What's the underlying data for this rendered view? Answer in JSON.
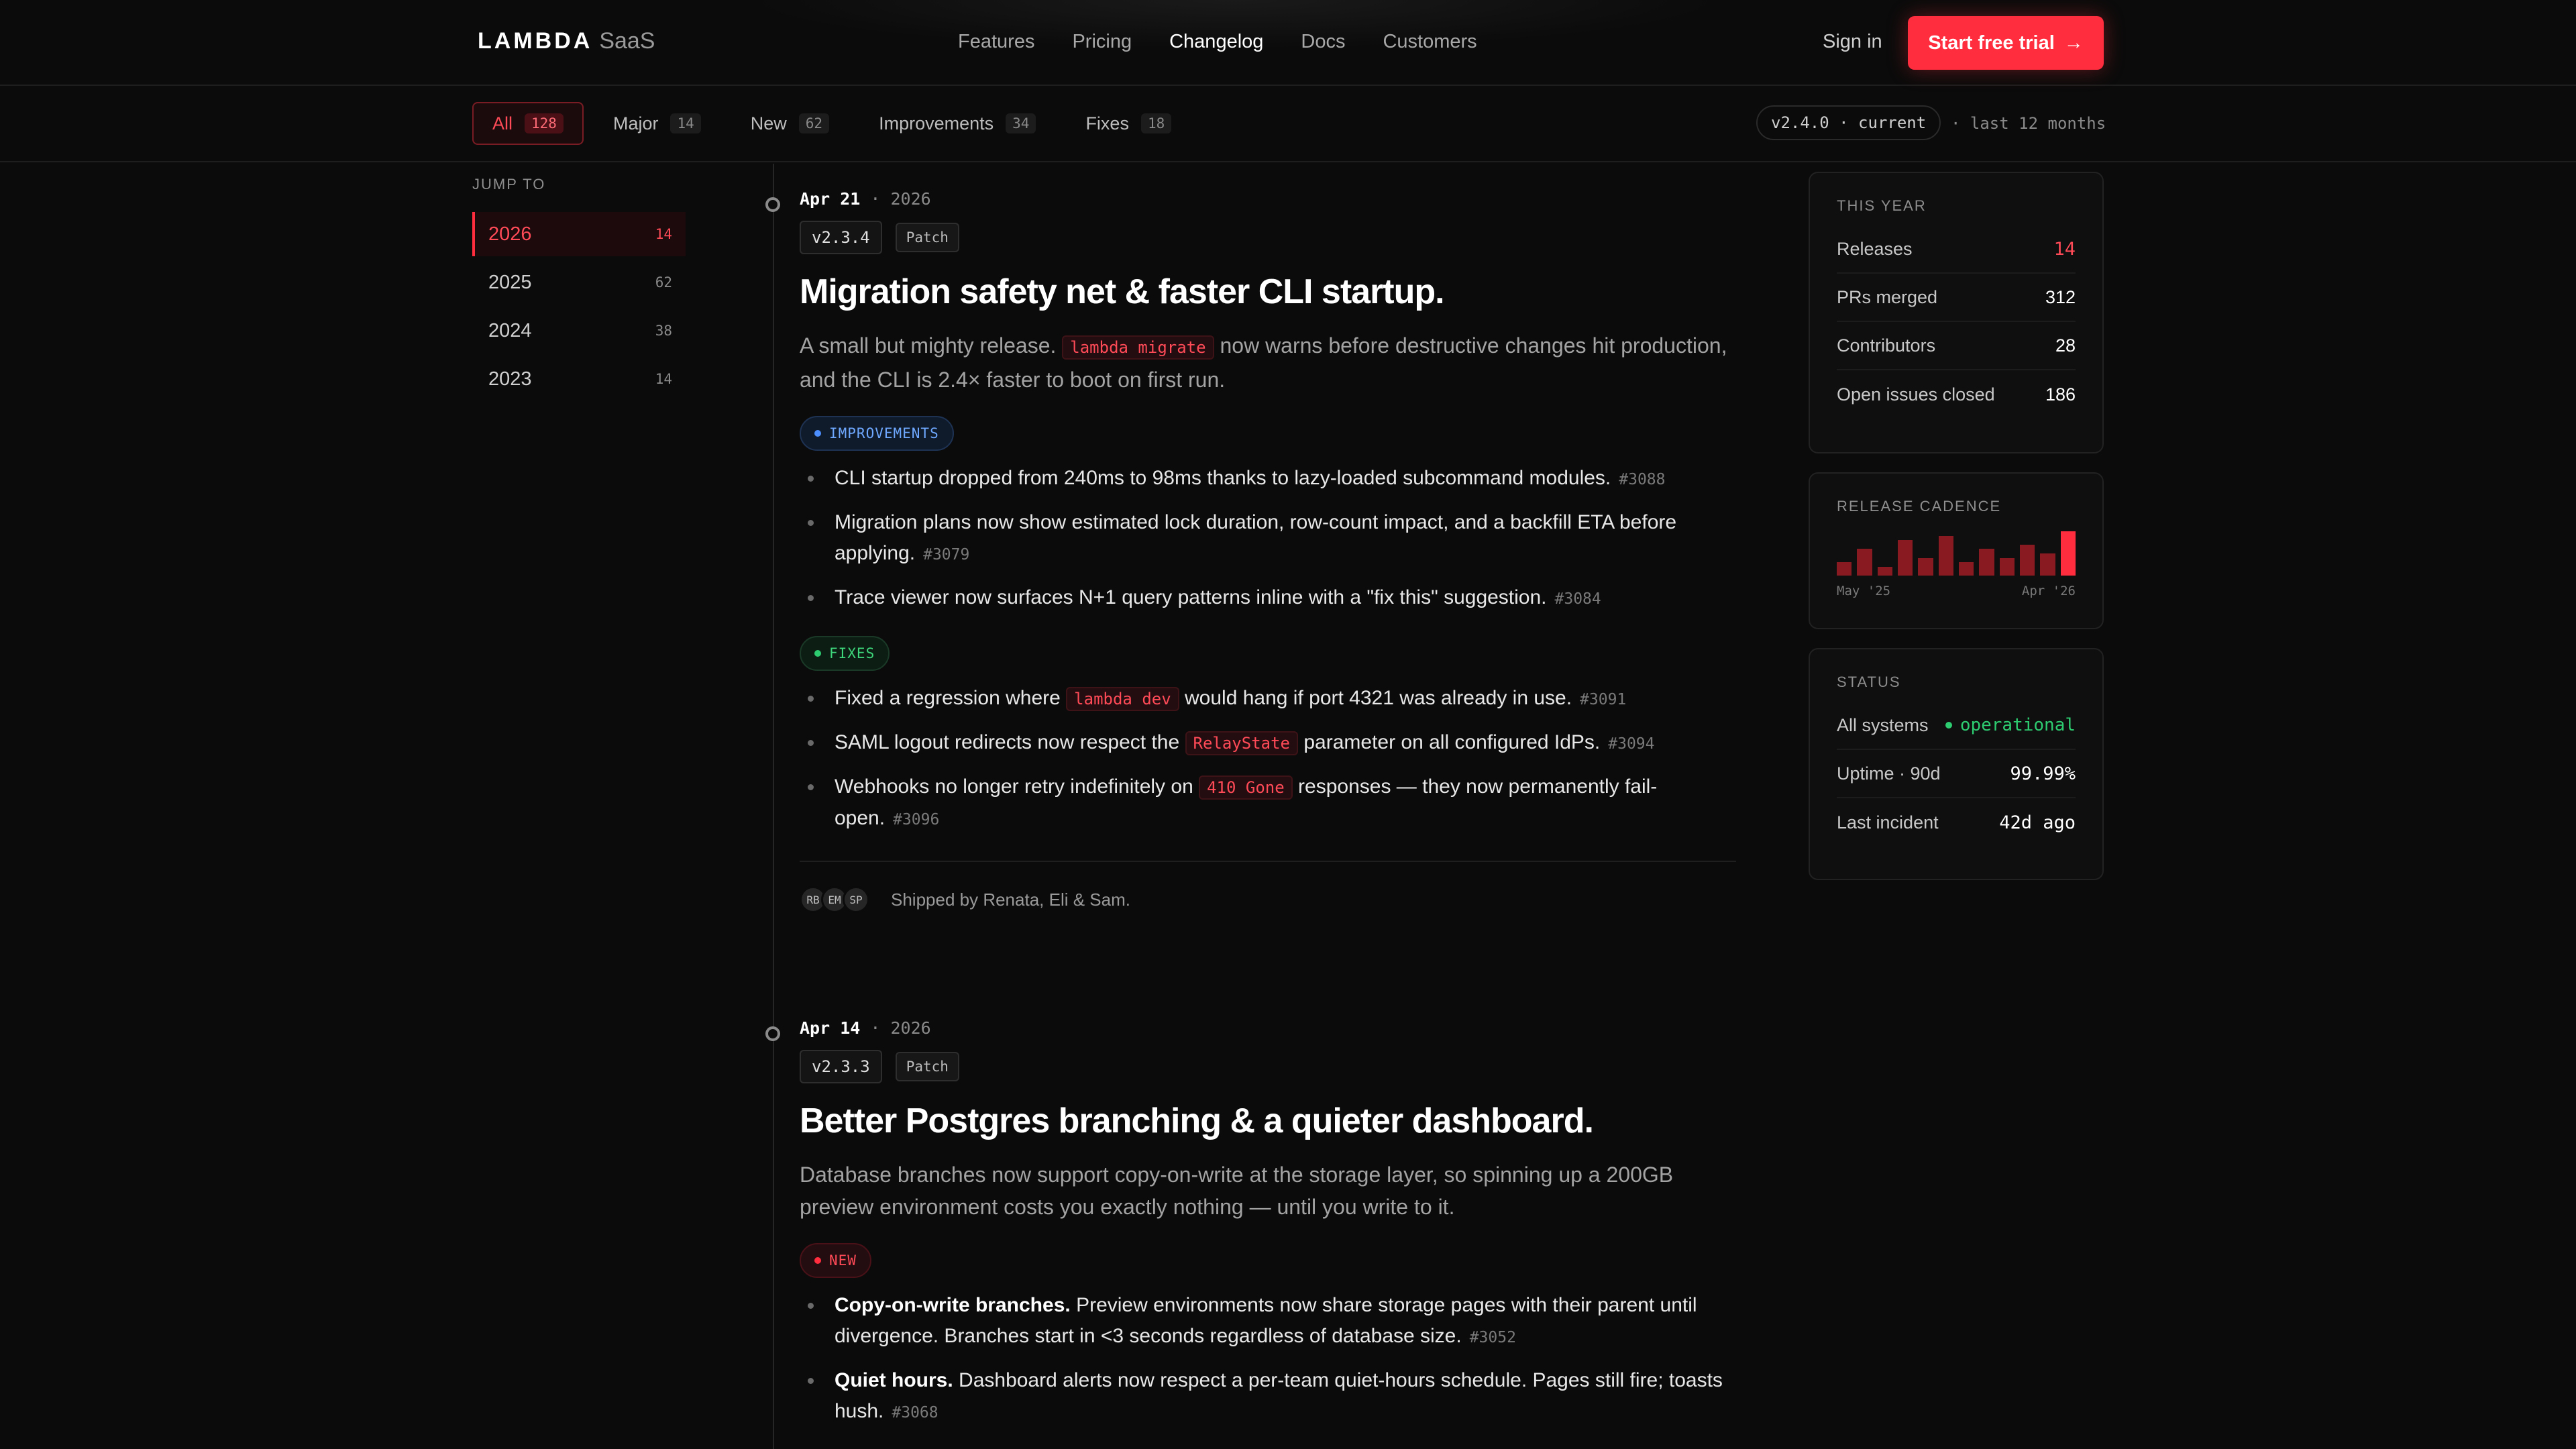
{
  "nav": {
    "brand": "LAMBDA",
    "product": "SaaS",
    "links": [
      "Features",
      "Pricing",
      "Changelog",
      "Docs",
      "Customers"
    ],
    "active_link": "Changelog",
    "signin": "Sign in",
    "cta": "Start free trial",
    "cta_arrow": "→"
  },
  "filters": {
    "chips": [
      {
        "label": "All",
        "count": "128"
      },
      {
        "label": "Major",
        "count": "14"
      },
      {
        "label": "New",
        "count": "62"
      },
      {
        "label": "Improvements",
        "count": "34"
      },
      {
        "label": "Fixes",
        "count": "18"
      }
    ],
    "version": "v2.4.0 · current",
    "range": "· last 12 months"
  },
  "sidebar": {
    "jump_label": "JUMP TO",
    "years": [
      {
        "year": "2026",
        "count": "14"
      },
      {
        "year": "2025",
        "count": "62"
      },
      {
        "year": "2024",
        "count": "38"
      },
      {
        "year": "2023",
        "count": "14"
      }
    ]
  },
  "entries": [
    {
      "date": "Apr 21",
      "year": "· 2026",
      "version": "v2.3.4",
      "kind": "Patch",
      "title": "Migration safety net & faster CLI startup.",
      "lead_pre": "A small but mighty release.",
      "lead_code": "lambda migrate",
      "lead_post": "now warns before destructive changes hit production, and the CLI is 2.4× faster to boot on first run.",
      "improvements_label": "IMPROVEMENTS",
      "improvements": [
        {
          "text": "CLI startup dropped from 240ms to 98ms thanks to lazy-loaded subcommand modules.",
          "pr": "#3088"
        },
        {
          "text": "Migration plans now show estimated lock duration, row-count impact, and a backfill ETA before applying.",
          "pr": "#3079"
        },
        {
          "text": "Trace viewer now surfaces N+1 query patterns inline with a \"fix this\" suggestion.",
          "pr": "#3084"
        }
      ],
      "fixes_label": "FIXES",
      "fixes": [
        {
          "pre": "Fixed a regression where",
          "code": "lambda dev",
          "post": "would hang if port 4321 was already in use.",
          "pr": "#3091"
        },
        {
          "pre": "SAML logout redirects now respect the",
          "code": "RelayState",
          "post": "parameter on all configured IdPs.",
          "pr": "#3094"
        },
        {
          "pre": "Webhooks no longer retry indefinitely on",
          "code": "410 Gone",
          "post": "responses — they now permanently fail-open.",
          "pr": "#3096"
        }
      ],
      "avatars": [
        "RB",
        "EM",
        "SP"
      ],
      "shipped": "Shipped by Renata, Eli & Sam."
    },
    {
      "date": "Apr 14",
      "year": "· 2026",
      "version": "v2.3.3",
      "kind": "Patch",
      "title": "Better Postgres branching & a quieter dashboard.",
      "lead": "Database branches now support copy-on-write at the storage layer, so spinning up a 200GB preview environment costs you exactly nothing — until you write to it.",
      "new_label": "NEW",
      "new_items": [
        {
          "bold": "Copy-on-write branches.",
          "text": "Preview environments now share storage pages with their parent until divergence. Branches start in <3 seconds regardless of database size.",
          "pr": "#3052"
        },
        {
          "bold": "Quiet hours.",
          "text": "Dashboard alerts now respect a per-team quiet-hours schedule. Pages still fire; toasts hush.",
          "pr": "#3068"
        }
      ]
    }
  ],
  "this_year": {
    "title": "THIS YEAR",
    "rows": [
      {
        "label": "Releases",
        "value": "14"
      },
      {
        "label": "PRs merged",
        "value": "312"
      },
      {
        "label": "Contributors",
        "value": "28"
      },
      {
        "label": "Open issues closed",
        "value": "186"
      }
    ]
  },
  "cadence": {
    "title": "RELEASE CADENCE",
    "start_label": "May '25",
    "end_label": "Apr '26",
    "values": [
      3,
      6,
      2,
      8,
      4,
      9,
      3,
      6,
      4,
      7,
      5,
      10
    ]
  },
  "status": {
    "title": "STATUS",
    "all_label": "All systems",
    "all_value": "operational",
    "uptime_label": "Uptime · 90d",
    "uptime_value": "99.99%",
    "incident_label": "Last incident",
    "incident_value": "42d ago"
  },
  "colors": {
    "accent": "#ff2d3d",
    "ok": "#2ecc71",
    "info": "#4d8eff"
  }
}
